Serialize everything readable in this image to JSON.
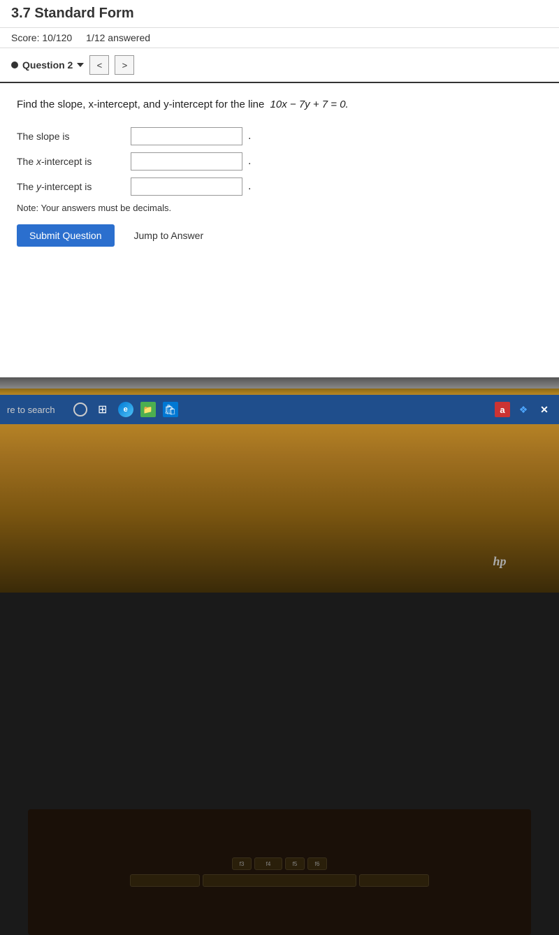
{
  "page": {
    "title": "3.7 Standard Form",
    "score": "Score: 10/120",
    "answered": "1/12 answered"
  },
  "question_nav": {
    "question_label": "Question 2",
    "dropdown_icon": "▼",
    "prev_label": "<",
    "next_label": ">"
  },
  "question": {
    "text": "Find the slope, x-intercept, and y-intercept for the line",
    "equation": "10x − 7y + 7 = 0.",
    "slope_label": "The slope is",
    "x_intercept_label": "The x-intercept is",
    "y_intercept_label": "The y-intercept is",
    "note": "Note: Your answers must be decimals.",
    "slope_value": "",
    "x_intercept_value": "",
    "y_intercept_value": ""
  },
  "buttons": {
    "submit": "Submit Question",
    "jump": "Jump to Answer"
  },
  "taskbar": {
    "search_placeholder": "re to search",
    "icons": [
      "○",
      "⊞",
      "e",
      "📁",
      "🛍",
      "a",
      "❖",
      "✕"
    ]
  },
  "laptop": {
    "hp_logo": "hp"
  }
}
